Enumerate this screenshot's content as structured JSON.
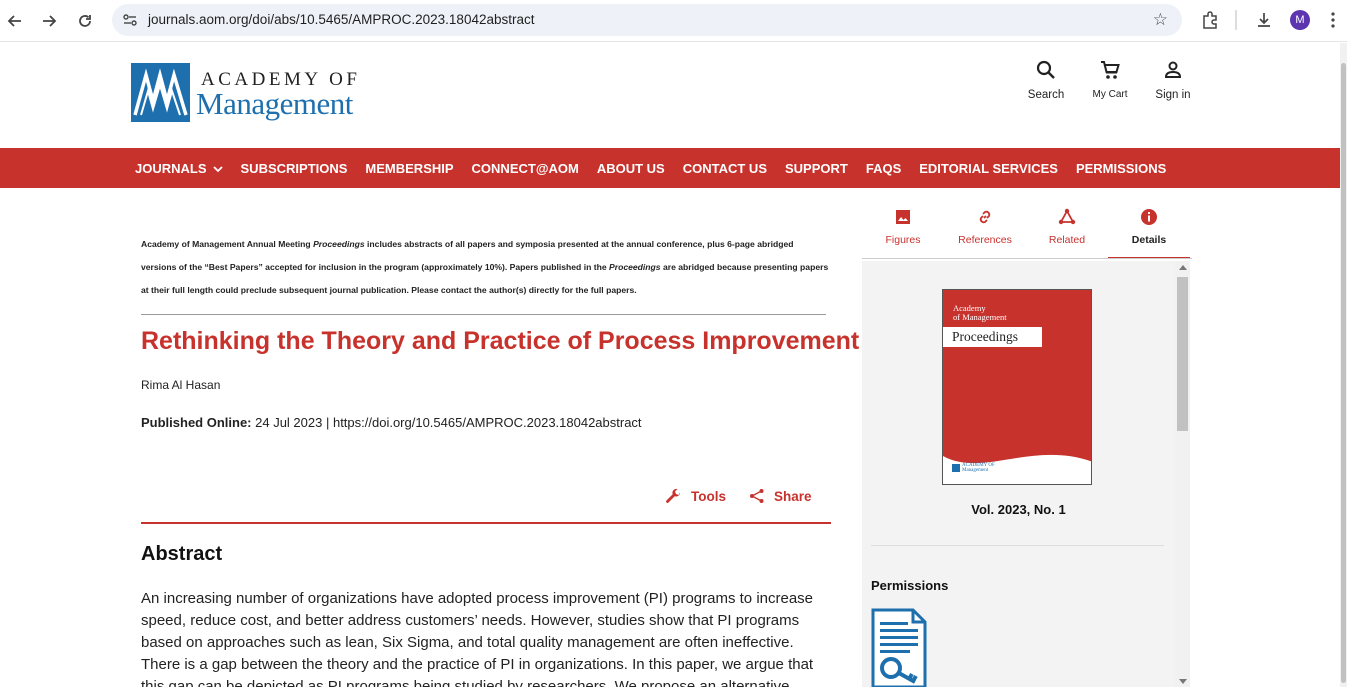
{
  "browser": {
    "url": "journals.aom.org/doi/abs/10.5465/AMPROC.2023.18042abstract",
    "profile_initial": "M"
  },
  "site": {
    "logo_top": "ACADEMY OF",
    "logo_bottom": "Management",
    "actions": [
      {
        "label": "Search",
        "icon": "search-icon"
      },
      {
        "label": "My Cart",
        "icon": "cart-icon"
      },
      {
        "label": "Sign in",
        "icon": "user-icon"
      }
    ]
  },
  "nav": {
    "items": [
      "JOURNALS",
      "SUBSCRIPTIONS",
      "MEMBERSHIP",
      "CONNECT@AOM",
      "ABOUT US",
      "CONTACT US",
      "SUPPORT",
      "FAQS",
      "EDITORIAL SERVICES",
      "PERMISSIONS"
    ]
  },
  "notice": {
    "p1": "Academy of Management Annual Meeting ",
    "p2": "Proceedings",
    "p3": " includes abstracts of all papers and symposia presented at the annual conference, plus 6-page abridged versions of the “Best Papers” accepted for inclusion in the program (approximately 10%). Papers published in the ",
    "p4": "Proceedings",
    "p5": " are abridged because presenting papers at their full length could preclude subsequent journal publication. Please contact the author(s) directly for the full papers."
  },
  "article": {
    "title": "Rethinking the Theory and Practice of Process Improvement",
    "author": "Rima Al Hasan",
    "published_label": "Published Online:",
    "published_date": " 24 Jul 2023",
    "separator": " | ",
    "doi": "https://doi.org/10.5465/AMPROC.2023.18042abstract",
    "tools_label": "Tools",
    "share_label": "Share",
    "abstract_heading": "Abstract",
    "abstract_text": "An increasing number of organizations have adopted process improvement (PI) programs to increase speed, reduce cost, and better address customers’ needs. However, studies show that PI programs based on approaches such as lean, Six Sigma, and total quality management are often ineffective. There is a gap between the theory and the practice of PI in organizations. In this paper, we argue that this gap can be depicted as PI programs being studied by researchers. We propose an alternative perspective"
  },
  "sidebar": {
    "tabs": [
      {
        "label": "Figures",
        "icon": "image-icon"
      },
      {
        "label": "References",
        "icon": "link-icon"
      },
      {
        "label": "Related",
        "icon": "network-icon"
      },
      {
        "label": "Details",
        "icon": "info-icon"
      }
    ],
    "active_tab": "Details",
    "cover": {
      "top_line1": "Academy",
      "top_line2": "of Management",
      "band": "Proceedings",
      "logo_line1": "ACADEMY OF",
      "logo_line2": "Management"
    },
    "volume": "Vol. 2023, No. 1",
    "permissions_heading": "Permissions"
  },
  "colors": {
    "brand_red": "#c8322d",
    "brand_blue": "#1e6fae"
  }
}
